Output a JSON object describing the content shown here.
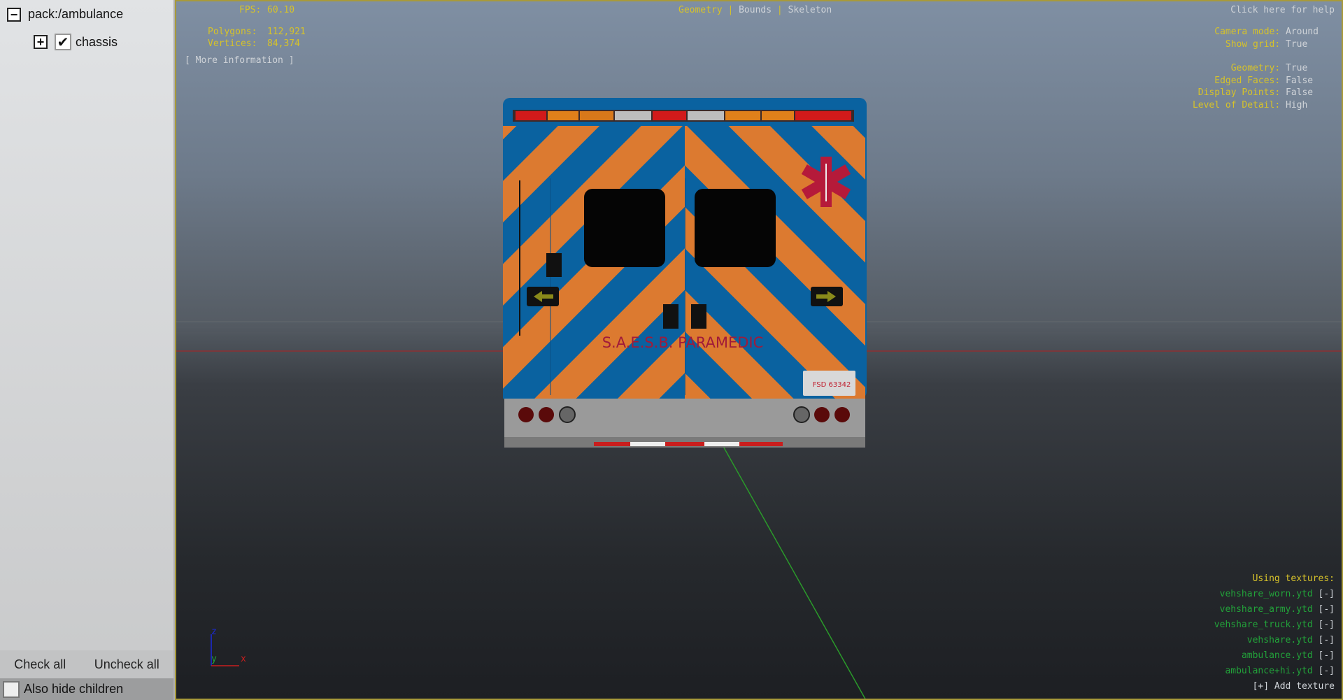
{
  "tree": {
    "root": "pack:/ambulance",
    "child": "chassis",
    "child_checked": true
  },
  "buttons": {
    "check_all": "Check all",
    "uncheck_all": "Uncheck all"
  },
  "also_hide": {
    "label": "Also hide children",
    "checked": false
  },
  "stats": {
    "fps_label": "FPS:",
    "fps": "60.10",
    "polygons_label": "Polygons:",
    "polygons": "112,921",
    "vertices_label": "Vertices:",
    "vertices": "84,374",
    "more_info": "[ More information ]"
  },
  "modes": {
    "geometry": "Geometry",
    "bounds": "Bounds",
    "skeleton": "Skeleton",
    "active": "Geometry"
  },
  "help": "Click here for help",
  "settings": [
    {
      "label": "Camera mode:",
      "value": "Around"
    },
    {
      "label": "Show grid:",
      "value": "True"
    },
    {
      "label": "Geometry:",
      "value": "True"
    },
    {
      "label": "Edged Faces:",
      "value": "False"
    },
    {
      "label": "Display Points:",
      "value": "False"
    },
    {
      "label": "Level of Detail:",
      "value": "High"
    }
  ],
  "textures": {
    "title": "Using textures:",
    "remove": "[-]",
    "items": [
      "vehshare_worn.ytd",
      "vehshare_army.ytd",
      "vehshare_truck.ytd",
      "vehshare.ytd",
      "ambulance.ytd",
      "ambulance+hi.ytd"
    ],
    "add": "[+] Add texture"
  },
  "axes": {
    "z": "z",
    "y": "y",
    "x": "x"
  },
  "model": {
    "text": "S.A.E.S.B. PARAMEDIC",
    "plate": "FSD 63342"
  },
  "colors": {
    "label": "#d6c22a",
    "value": "#cfd3d8",
    "texture": "#22a23a",
    "stripe_orange": "#dc7a30",
    "stripe_blue": "#0a62a0"
  }
}
